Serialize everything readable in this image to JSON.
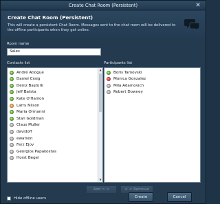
{
  "window": {
    "title": "Create Chat Room (Persistent)",
    "close_glyph": "✕"
  },
  "header": {
    "title": "Create Chat Room (Persistent)",
    "description": "This will create a persistent Chat Room. Messages sent to the chat room will be delivered to the offline participants when they get online.",
    "icon": "chat-bubbles-icon"
  },
  "room_name": {
    "label": "Room name",
    "value": "Sales"
  },
  "contacts": {
    "label": "Contacts list",
    "items": [
      {
        "name": "André Atiogue",
        "status": "green"
      },
      {
        "name": "Daniel Craig",
        "status": "green"
      },
      {
        "name": "Deniz Baştürk",
        "status": "green"
      },
      {
        "name": "Jeff Batsta",
        "status": "green"
      },
      {
        "name": "Kate O'Hanlon",
        "status": "green"
      },
      {
        "name": "Larry Nilson",
        "status": "orange"
      },
      {
        "name": "Maria Ormanni",
        "status": "green"
      },
      {
        "name": "Stan Goldman",
        "status": "green"
      },
      {
        "name": "Claus Muller",
        "status": "grey"
      },
      {
        "name": "davidoff",
        "status": "grey"
      },
      {
        "name": "ewatson",
        "status": "grey"
      },
      {
        "name": "Ferz Ejov",
        "status": "grey"
      },
      {
        "name": "Georgios Papakostas",
        "status": "grey"
      },
      {
        "name": "Horst Begel",
        "status": "grey"
      }
    ]
  },
  "participants": {
    "label": "Participants list",
    "items": [
      {
        "name": "Boris Tamovski",
        "status": "green"
      },
      {
        "name": "Monica Gonzalez",
        "status": "red"
      },
      {
        "name": "Mila Adamovich",
        "status": "grey"
      },
      {
        "name": "Robert Downey",
        "status": "grey"
      }
    ]
  },
  "buttons": {
    "add": "Add > >",
    "remove": "< < Remove",
    "create": "Create",
    "cancel": "Cancel"
  },
  "hide_offline": {
    "label": "Hide offline users",
    "checked": false
  },
  "colors": {
    "background": "#243a4f",
    "online": "#3d9b16",
    "away": "#e08a12",
    "busy": "#c41818",
    "offline": "#9a9a9a"
  }
}
